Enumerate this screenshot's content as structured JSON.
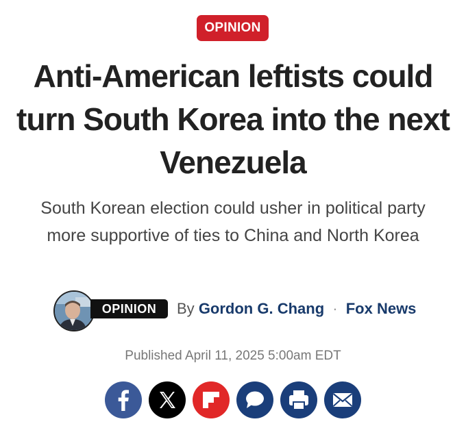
{
  "article": {
    "section_badge": "OPINION",
    "headline": "Anti-American leftists could turn South Korea into the next Venezuela",
    "subheadline": "South Korean election could usher in political party more supportive of ties to China and North Korea",
    "byline": {
      "opinion_label": "OPINION",
      "by_prefix": "By",
      "author": "Gordon G. Chang",
      "separator": "·",
      "outlet": "Fox News"
    },
    "published": "Published April 11, 2025 5:00am EDT"
  },
  "share": {
    "buttons": [
      {
        "icon": "facebook-icon",
        "color": "#3b5998"
      },
      {
        "icon": "x-icon",
        "color": "#000000"
      },
      {
        "icon": "flipboard-icon",
        "color": "#e12828"
      },
      {
        "icon": "comment-icon",
        "color": "#1a3e7a"
      },
      {
        "icon": "print-icon",
        "color": "#1a3e7a"
      },
      {
        "icon": "email-icon",
        "color": "#1a3e7a"
      }
    ]
  },
  "colors": {
    "badge_red": "#d0202a",
    "author_blue": "#183a6b",
    "headline": "#222222"
  }
}
